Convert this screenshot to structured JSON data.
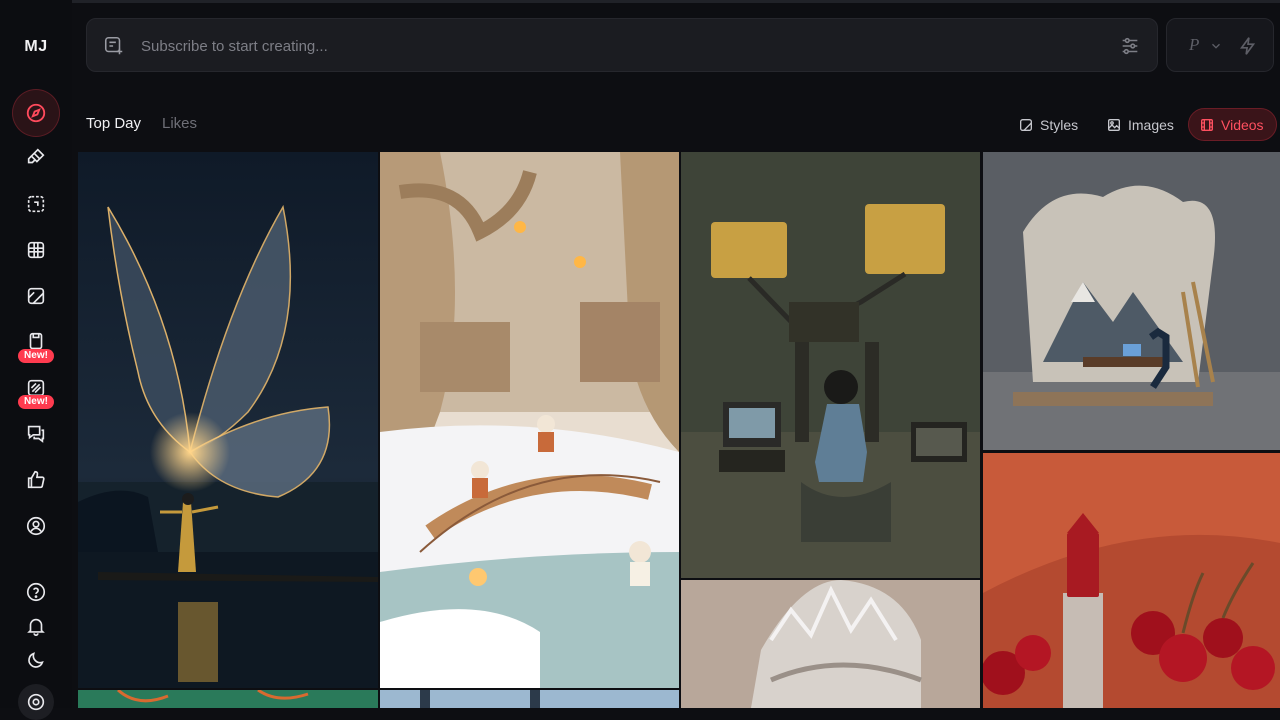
{
  "app": {
    "logo": "MJ",
    "accent": "#ff3b4f"
  },
  "sidebar": {
    "items": [
      {
        "icon": "compass-icon",
        "active": true
      },
      {
        "icon": "brush-icon"
      },
      {
        "icon": "edit-image-icon"
      },
      {
        "icon": "globe-grid-icon"
      },
      {
        "icon": "style-book-icon"
      },
      {
        "icon": "moodboard-icon",
        "badge": "New!"
      },
      {
        "icon": "personalize-icon",
        "badge": "New!"
      },
      {
        "icon": "chat-icon"
      },
      {
        "icon": "thumbs-up-icon"
      },
      {
        "icon": "user-circle-icon"
      }
    ],
    "bottom": [
      {
        "icon": "help-icon"
      },
      {
        "icon": "bell-icon"
      },
      {
        "icon": "moon-icon"
      },
      {
        "icon": "settings-icon"
      }
    ],
    "badge_text": "New!"
  },
  "prompt": {
    "placeholder": "Subscribe to start creating..."
  },
  "mode": {
    "letter": "P"
  },
  "tabs": {
    "top_day": "Top Day",
    "likes": "Likes"
  },
  "filters": {
    "styles": "Styles",
    "images": "Images",
    "videos": "Videos"
  },
  "gallery": {
    "items": [
      {
        "subject": "glowing-butterfly"
      },
      {
        "subject": "snowy-miniature-village"
      },
      {
        "subject": "robot-and-typewriter"
      },
      {
        "subject": "cloud-mountain-desk"
      },
      {
        "subject": "silver-crown"
      },
      {
        "subject": "lipstick-cherries"
      },
      {
        "subject": "green-foliage"
      },
      {
        "subject": "blue-window"
      }
    ]
  }
}
